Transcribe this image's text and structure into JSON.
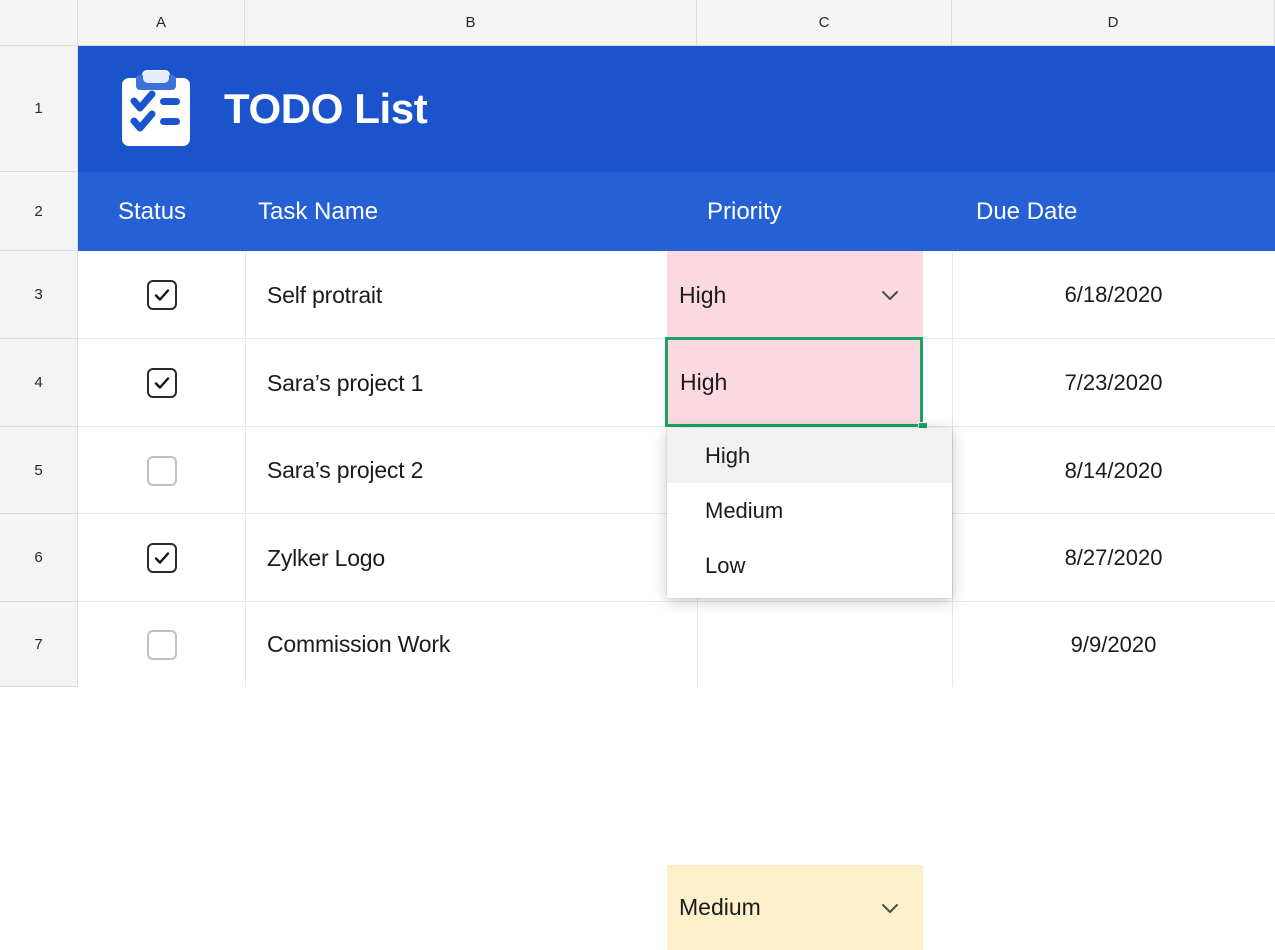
{
  "grid": {
    "column_headers": [
      "A",
      "B",
      "C",
      "D"
    ],
    "row_headers": [
      "1",
      "2",
      "3",
      "4",
      "5",
      "6",
      "7"
    ]
  },
  "banner": {
    "title": "TODO List",
    "icon": "clipboard-checklist-icon",
    "background": "#1a53cc"
  },
  "table": {
    "header_background": "#2560d5",
    "columns": [
      {
        "label": "Status"
      },
      {
        "label": "Task Name"
      },
      {
        "label": "Priority"
      },
      {
        "label": "Due Date"
      }
    ],
    "rows": [
      {
        "status_checked": true,
        "status_label": "checked",
        "task": "Self protrait",
        "priority": "High",
        "priority_color": "#fbd9e1",
        "due_date": "6/18/2020"
      },
      {
        "status_checked": true,
        "status_label": "checked",
        "task": "Sara’s project 1",
        "priority": "High",
        "priority_color": "#fbd9e1",
        "due_date": "7/23/2020"
      },
      {
        "status_checked": false,
        "status_label": "unchecked",
        "task": "Sara’s project 2",
        "priority": "",
        "priority_color": "#ffffff",
        "due_date": "8/14/2020"
      },
      {
        "status_checked": true,
        "status_label": "checked",
        "task": "Zylker Logo",
        "priority": "",
        "priority_color": "#ffffff",
        "due_date": "8/27/2020"
      },
      {
        "status_checked": false,
        "status_label": "unchecked",
        "task": "Commission Work",
        "priority": "Medium",
        "priority_color": "#fcf0ca",
        "due_date": "9/9/2020"
      }
    ]
  },
  "selection": {
    "value": "High",
    "border_color": "#19a463",
    "cell_reference": "C4"
  },
  "dropdown": {
    "open": true,
    "options": [
      {
        "label": "High",
        "highlighted": true
      },
      {
        "label": "Medium",
        "highlighted": false
      },
      {
        "label": "Low",
        "highlighted": false
      }
    ]
  }
}
